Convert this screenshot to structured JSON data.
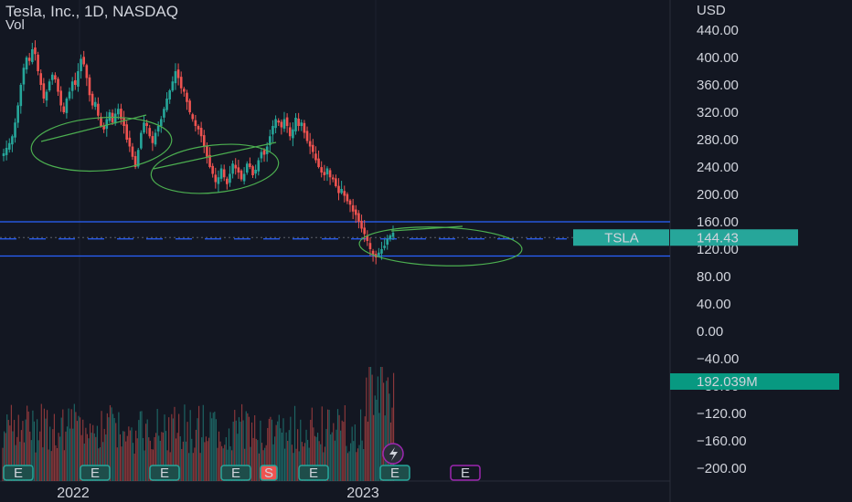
{
  "header": {
    "title": "Tesla, Inc., 1D, NASDAQ",
    "volume_label": "Vol",
    "currency": "USD"
  },
  "price_tag": {
    "symbol": "TSLA",
    "value": "144.43"
  },
  "volume_tag": {
    "value": "192.039M"
  },
  "event_markers": [
    {
      "label": "E"
    },
    {
      "label": "E"
    },
    {
      "label": "E"
    },
    {
      "label": "E"
    },
    {
      "label": "S"
    },
    {
      "label": "E"
    },
    {
      "label": "E"
    },
    {
      "label": "E"
    }
  ],
  "colors": {
    "background": "#131722",
    "up": "#26a69a",
    "down": "#ef5350",
    "level_line": "#2962ff",
    "annotation": "#4caf50",
    "tag": "#26a69a",
    "volume_tag": "#089981",
    "marker_purple": "#9c27b0"
  },
  "chart_data": {
    "type": "candlestick",
    "y_ticks": [
      "440.00",
      "400.00",
      "360.00",
      "320.00",
      "280.00",
      "240.00",
      "200.00",
      "160.00",
      "120.00",
      "80.00",
      "40.00",
      "0.00",
      "−40.00",
      "−80.00",
      "−120.00",
      "−160.00",
      "−200.00"
    ],
    "x_ticks": [
      "2022",
      "2023"
    ],
    "levels": [
      {
        "value": 160,
        "style": "solid"
      },
      {
        "value": 135,
        "style": "dashed"
      },
      {
        "value": 110,
        "style": "solid"
      }
    ],
    "ylim": [
      -200,
      440
    ],
    "series": [
      {
        "values": [
          260,
          268,
          275,
          285,
          305,
          330,
          360,
          385,
          400,
          395,
          412,
          405,
          380,
          360,
          340,
          350,
          365,
          375,
          368,
          350,
          330,
          320,
          340,
          350,
          365,
          360,
          380,
          398,
          390,
          370,
          345,
          330,
          335,
          315,
          300,
          295,
          310,
          320,
          305,
          318,
          325,
          310,
          300,
          280,
          270,
          255,
          240,
          265,
          290,
          305,
          300,
          285,
          275,
          290,
          300,
          310,
          325,
          340,
          352,
          365,
          380,
          370,
          355,
          350,
          335,
          320,
          310,
          300,
          295,
          285,
          270,
          255,
          240,
          230,
          218,
          225,
          238,
          225,
          215,
          230,
          245,
          238,
          232,
          222,
          230,
          245,
          240,
          228,
          236,
          250,
          262,
          258,
          270,
          285,
          300,
          310,
          305,
          298,
          310,
          300,
          285,
          295,
          312,
          300,
          305,
          290,
          278,
          270,
          262,
          250,
          240,
          232,
          228,
          238,
          225,
          222,
          212,
          202,
          208,
          198,
          190,
          185,
          175,
          170,
          160,
          150,
          142,
          132,
          120,
          112,
          108,
          115,
          120,
          125,
          135,
          140,
          144
        ]
      }
    ]
  }
}
